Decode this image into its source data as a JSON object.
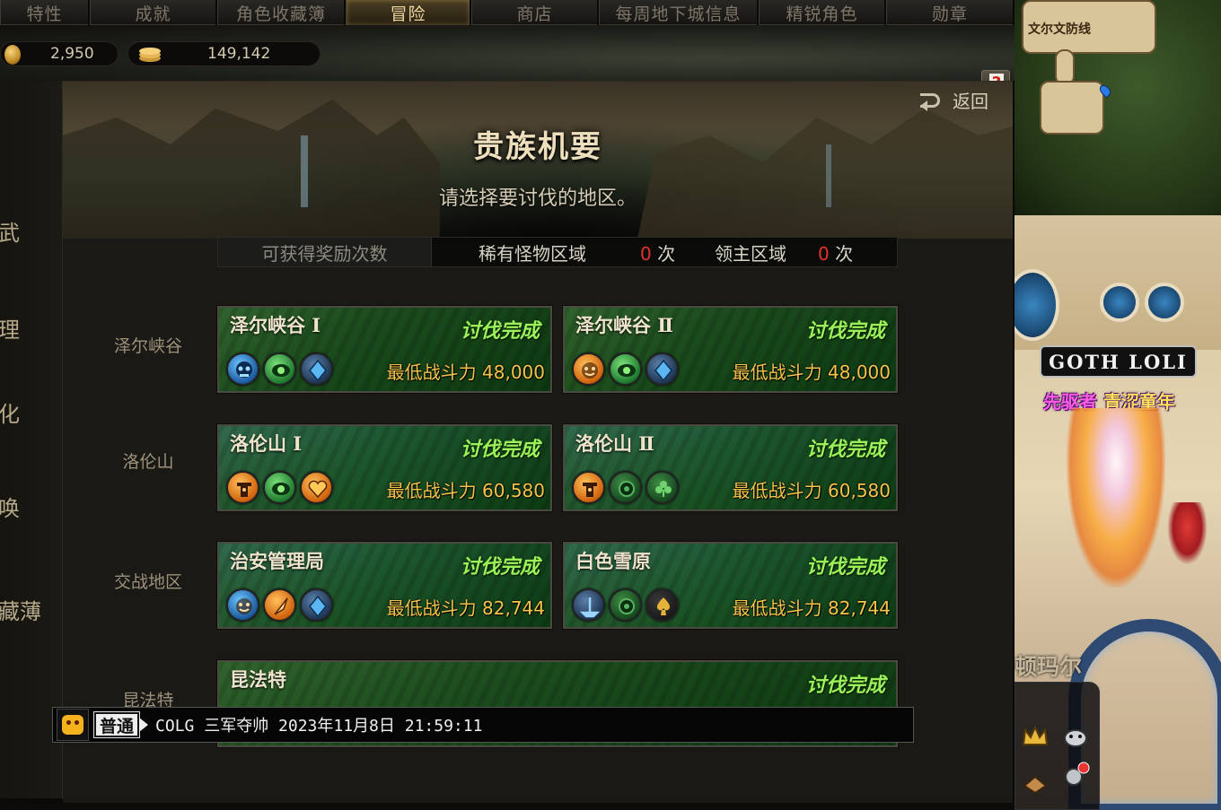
{
  "tabs": [
    {
      "label": "特性",
      "w": 100
    },
    {
      "label": "成就",
      "w": 142
    },
    {
      "label": "角色收藏簿",
      "w": 143
    },
    {
      "label": "冒险",
      "w": 140,
      "active": true
    },
    {
      "label": "商店",
      "w": 142
    },
    {
      "label": "每周地下城信息",
      "w": 178
    },
    {
      "label": "精锐角色",
      "w": 142
    },
    {
      "label": "勋章",
      "w": 143
    }
  ],
  "currency": {
    "gold": "2,950",
    "stack": "149,142"
  },
  "left_menu": [
    "武",
    "理",
    "化",
    "唤",
    "藏薄"
  ],
  "panel": {
    "title": "贵族机要",
    "subtitle": "请选择要讨伐的地区。",
    "back_label": "返回"
  },
  "reward_bar": {
    "label": "可获得奖励次数",
    "rare_label": "稀有怪物区域",
    "rare_count": "0",
    "boss_label": "领主区域",
    "boss_count": "0",
    "unit": "次"
  },
  "regions": [
    {
      "label": "泽尔峡谷",
      "cards": [
        {
          "name": "泽尔峡谷 Ⅰ",
          "status": "讨伐完成",
          "power_label": "最低战斗力",
          "power": "48,000",
          "icons": [
            [
              "i-blue",
              "skull"
            ],
            [
              "i-green",
              "eye"
            ],
            [
              "i-navy",
              "diamond"
            ]
          ]
        },
        {
          "name": "泽尔峡谷 Ⅱ",
          "status": "讨伐完成",
          "power_label": "最低战斗力",
          "power": "48,000",
          "icons": [
            [
              "i-orange",
              "face"
            ],
            [
              "i-green",
              "eye"
            ],
            [
              "i-navy",
              "diamond"
            ]
          ]
        }
      ]
    },
    {
      "label": "洛伦山",
      "cards": [
        {
          "name": "洛伦山 Ⅰ",
          "status": "讨伐完成",
          "power_label": "最低战斗力",
          "power": "60,580",
          "icons": [
            [
              "i-orange",
              "totem"
            ],
            [
              "i-green",
              "eye"
            ],
            [
              "i-orange",
              "heart"
            ]
          ]
        },
        {
          "name": "洛伦山 Ⅱ",
          "status": "讨伐完成",
          "power_label": "最低战斗力",
          "power": "60,580",
          "icons": [
            [
              "i-orange",
              "totem"
            ],
            [
              "i-darkgreen",
              "gear"
            ],
            [
              "i-darkgreen",
              "club"
            ]
          ]
        }
      ]
    },
    {
      "label": "交战地区",
      "cards": [
        {
          "name": "治安管理局",
          "status": "讨伐完成",
          "power_label": "最低战斗力",
          "power": "82,744",
          "icons": [
            [
              "i-blue",
              "face"
            ],
            [
              "i-orange",
              "feather"
            ],
            [
              "i-navy",
              "diamond"
            ]
          ]
        },
        {
          "name": "白色雪原",
          "status": "讨伐完成",
          "power_label": "最低战斗力",
          "power": "82,744",
          "icons": [
            [
              "i-navy",
              "ship"
            ],
            [
              "i-darkgreen",
              "gear"
            ],
            [
              "i-dark",
              "spade"
            ]
          ]
        }
      ]
    },
    {
      "label": "昆法特",
      "cards": [
        {
          "name": "昆法特",
          "status": "讨伐完成"
        }
      ]
    }
  ],
  "chat": {
    "channel": "普通",
    "message": "COLG 三军夺帅 2023年11月8日 21:59:11"
  },
  "world": {
    "minimap_label": "文尔文防线",
    "guild_tag": "GOTH LOLI",
    "title_prefix": "先驱者",
    "title_name": "青涩童年",
    "sign": "顿玛尔"
  },
  "colors": {
    "status_green": "#9cf05a",
    "power_gold": "#f7c44a",
    "active_tab": "#f0d9a0",
    "count_red": "#e3342b"
  }
}
